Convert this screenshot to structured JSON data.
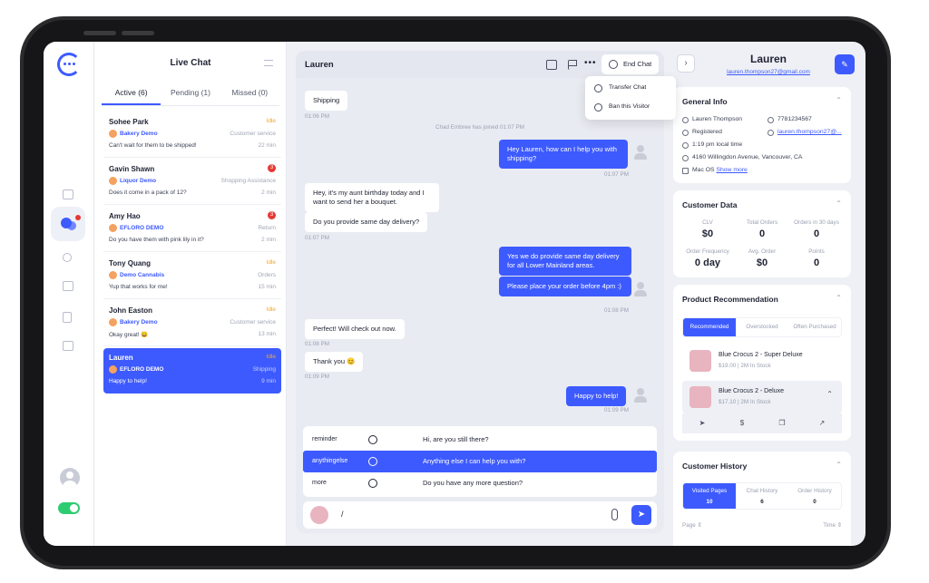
{
  "sidebar": {
    "items": [
      "dashboard-icon",
      "chat-icon",
      "users-icon",
      "inbox-icon",
      "document-icon",
      "analytics-icon"
    ],
    "toggle_on": true
  },
  "chat_list": {
    "title": "Live Chat",
    "tabs": [
      {
        "label": "Active (6)",
        "active": true
      },
      {
        "label": "Pending (1)",
        "active": false
      },
      {
        "label": "Missed (0)",
        "active": false
      }
    ],
    "items": [
      {
        "name": "Sohee Park",
        "status": "Idle",
        "store": "Bakery Demo",
        "category": "Customer service",
        "message": "Can't wait for them to be shipped!",
        "time": "22 min"
      },
      {
        "name": "Gavin Shawn",
        "badge": "3",
        "store": "Liquor Demo",
        "category": "Shopping Assistance",
        "message": "Does it come in a pack of 12?",
        "time": "2 min"
      },
      {
        "name": "Amy Hao",
        "badge": "3",
        "store": "EFLORO DEMO",
        "category": "Return",
        "message": "Do you have them with pink lily in it?",
        "time": "2 min"
      },
      {
        "name": "Tony Quang",
        "status": "Idle",
        "store": "Demo Cannabis",
        "category": "Orders",
        "message": "Yup that works for me!",
        "time": "15 min"
      },
      {
        "name": "John Easton",
        "status": "Idle",
        "store": "Bakery Demo",
        "category": "Customer service",
        "message": "Okay great! 😀",
        "time": "13 min"
      },
      {
        "name": "Lauren",
        "status": "Idle",
        "store": "EFLORO DEMO",
        "category": "Shipping",
        "message": "Happy to help!",
        "time": "9 min",
        "selected": true
      }
    ]
  },
  "conversation": {
    "title": "Lauren",
    "end_chat": "End Chat",
    "more": "•••",
    "menu": {
      "transfer": "Transfer Chat",
      "ban": "Ban this Visitor"
    },
    "system_message": "Chad Embree has joined 01:07 PM",
    "messages": [
      {
        "dir": "in",
        "text": "Shipping",
        "stamp": "01:06 PM"
      },
      {
        "dir": "out",
        "text": "Hey Lauren, how can I help you with shipping?",
        "stamp": "01:07 PM"
      },
      {
        "dir": "in",
        "text": "Hey, it's my aunt birthday today and I want to send her a bouquet."
      },
      {
        "dir": "in",
        "text": "Do you provide same day delivery?",
        "stamp": "01:07 PM"
      },
      {
        "dir": "out",
        "text": "Yes we do provide same day delivery for all Lower Mainland areas."
      },
      {
        "dir": "out",
        "text": "Please place your order before 4pm :)",
        "stamp": "01:08 PM"
      },
      {
        "dir": "in",
        "text": "Perfect! Will check out now.",
        "stamp": "01:08 PM"
      },
      {
        "dir": "in",
        "text": "Thank you 😊",
        "stamp": "01:09 PM"
      },
      {
        "dir": "out",
        "text": "Happy to help!",
        "stamp": "01:09 PM"
      }
    ],
    "canned": [
      {
        "key": "reminder",
        "text": "Hi, are you still there?",
        "highlighted": false
      },
      {
        "key": "anythingelse",
        "text": "Anything else I can help you with?",
        "highlighted": true
      },
      {
        "key": "more",
        "text": "Do you have any more question?",
        "highlighted": false
      }
    ],
    "composer_value": "/"
  },
  "customer": {
    "name": "Lauren",
    "email": "lauren.thompson27@gmail.com",
    "general_info": {
      "title": "General Info",
      "full_name": "Lauren Thompson",
      "phone": "7781234567",
      "registered": "Registered",
      "email_short": "lauren.thompson27@...",
      "local_time": "1:19 pm local time",
      "address": "4160 Willingdon Avenue, Vancouver, CA",
      "os": "Mac OS",
      "show_more": "Show more"
    },
    "data": {
      "title": "Customer Data",
      "metrics": [
        {
          "label": "CLV",
          "value": "$0"
        },
        {
          "label": "Total Orders",
          "value": "0"
        },
        {
          "label": "Orders in 30 days",
          "value": "0"
        },
        {
          "label": "Order Frequency",
          "value": "0 day"
        },
        {
          "label": "Avg. Order",
          "value": "$0"
        },
        {
          "label": "Points",
          "value": "0"
        }
      ]
    },
    "recommendation": {
      "title": "Product Recommendation",
      "tabs": [
        "Recommended",
        "Overstocked",
        "Often Purchased"
      ],
      "products": [
        {
          "name": "Blue Crocus 2 - Super Deluxe",
          "meta": "$19.00 | 2M In Stock"
        },
        {
          "name": "Blue Crocus 2 - Deluxe",
          "meta": "$17.10 | 2M In Stock"
        }
      ]
    },
    "history": {
      "title": "Customer History",
      "tabs": [
        {
          "label": "Visited Pages",
          "count": "10"
        },
        {
          "label": "Chat History",
          "count": "6"
        },
        {
          "label": "Order History",
          "count": "0"
        }
      ],
      "col_page": "Page ⇕",
      "col_time": "Time ⇕"
    }
  },
  "colors": {
    "accent": "#3d5afe",
    "idle": "#f5a623",
    "badge": "#e53935",
    "online": "#2ecc71"
  }
}
